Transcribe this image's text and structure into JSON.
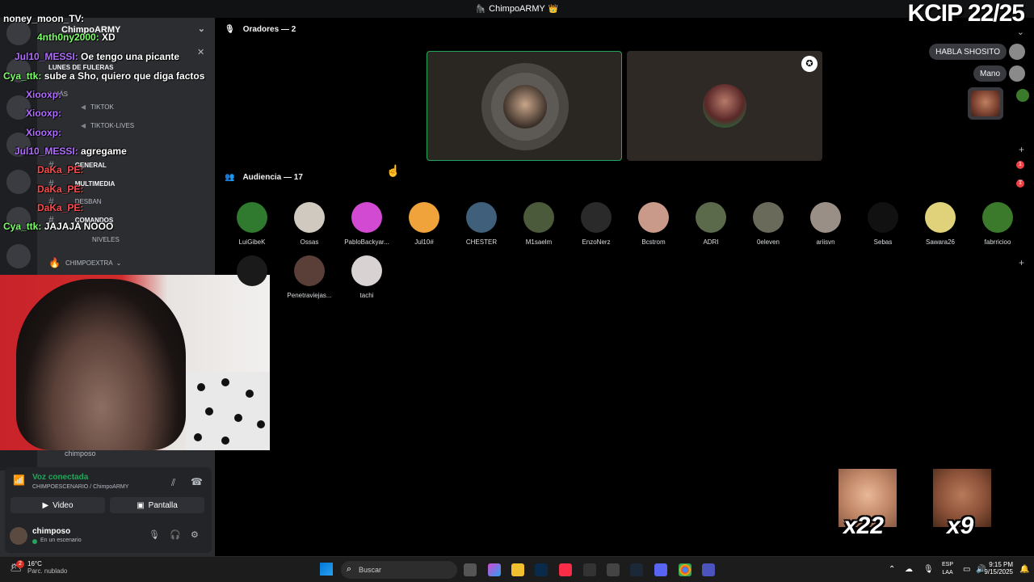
{
  "window": {
    "title": "ChimpoARMY"
  },
  "server": {
    "name": "ChimpoARMY"
  },
  "channels": [
    {
      "name": "LUNES DE FULERAS",
      "bold": true
    },
    {
      "name": "1 más",
      "bold": false
    },
    {
      "name": "TIKTOK",
      "bold": false
    },
    {
      "name": "TIKTOK-LIVES",
      "bold": false
    },
    {
      "name": "GENERAL",
      "bold": true,
      "badge": "1"
    },
    {
      "name": "MULTIMEDIA",
      "bold": true,
      "badge": "1"
    },
    {
      "name": "DESBAN",
      "bold": false
    },
    {
      "name": "COMANDOS",
      "bold": true
    },
    {
      "name": "NIVELES",
      "bold": false
    }
  ],
  "category": {
    "name": "CHIMPOEXTRA"
  },
  "chat": [
    {
      "user": "noney_moon_TV:",
      "msg": "",
      "color": "white"
    },
    {
      "user": "4nth0ny2000:",
      "msg": "XD",
      "color": "green"
    },
    {
      "user": "Jul10_MESSI:",
      "msg": "Oe tengo una picante",
      "color": "purple"
    },
    {
      "user": "Cya_ttk:",
      "msg": "sube a Sho, quiero que diga factos",
      "color": "green"
    },
    {
      "user": "Xiooxp:",
      "msg": "",
      "color": "purple"
    },
    {
      "user": "Xiooxp:",
      "msg": "",
      "color": "purple"
    },
    {
      "user": "Xiooxp:",
      "msg": "",
      "color": "purple"
    },
    {
      "user": "Jul10_MESSI:",
      "msg": "agregame",
      "color": "purple"
    },
    {
      "user": "DaKa_PE:",
      "msg": "",
      "color": "red"
    },
    {
      "user": "DaKa_PE:",
      "msg": "",
      "color": "red"
    },
    {
      "user": "DaKa_PE:",
      "msg": "",
      "color": "red"
    },
    {
      "user": "Cya_ttk:",
      "msg": "JAJAJA NOOO",
      "color": "green"
    }
  ],
  "voice": {
    "status": "Voz conectada",
    "channel": "CHIMPOESCENARIO / ChimpoARMY",
    "video_label": "Video",
    "screen_label": "Pantalla",
    "member_label": "chimposo"
  },
  "user": {
    "name": "chimposo",
    "status": "En un escenario"
  },
  "stage": {
    "speakers_header": "Oradores — 2",
    "audience_header": "Audiencia — 17"
  },
  "audience": [
    {
      "name": "LuiGibeK",
      "color": "#2f7a2f"
    },
    {
      "name": "Ossas",
      "color": "#cfc9bf"
    },
    {
      "name": "PabloBackyar...",
      "color": "#d14ad1"
    },
    {
      "name": "Jul10#",
      "color": "#f0a23b"
    },
    {
      "name": "CHESTER",
      "color": "#3f5f7a"
    },
    {
      "name": "M1saelm",
      "color": "#4a5a3a"
    },
    {
      "name": "EnzoNerz",
      "color": "#2a2a2a"
    },
    {
      "name": "Bcstrom",
      "color": "#c99a8a"
    },
    {
      "name": "ADRI",
      "color": "#5a6a4a"
    },
    {
      "name": "0eleven",
      "color": "#6a6a5a"
    },
    {
      "name": "ariisvn",
      "color": "#9a8f86"
    },
    {
      "name": "Sebas",
      "color": "#111111"
    },
    {
      "name": "Sawara26",
      "color": "#e0d27a"
    },
    {
      "name": "fabrricioo",
      "color": "#3a7a2a"
    },
    {
      "name": "",
      "color": "#1a1a1a"
    },
    {
      "name": "Penetraviejas...",
      "color": "#5a3f38"
    },
    {
      "name": "tachi",
      "color": "#d8d2d2"
    }
  ],
  "overlay": {
    "kcip": "KCIP 22/25",
    "requests": [
      "HABLA SHOSITO",
      "Mano"
    ],
    "emote_counts": [
      "x22",
      "x9"
    ]
  },
  "taskbar": {
    "temp": "16°C",
    "weather": "Parc. nublado",
    "search_placeholder": "Buscar",
    "lang_top": "ESP",
    "lang_bottom": "LAA",
    "time": "9:15 PM",
    "date": "9/15/2025",
    "notif_count": "2"
  }
}
